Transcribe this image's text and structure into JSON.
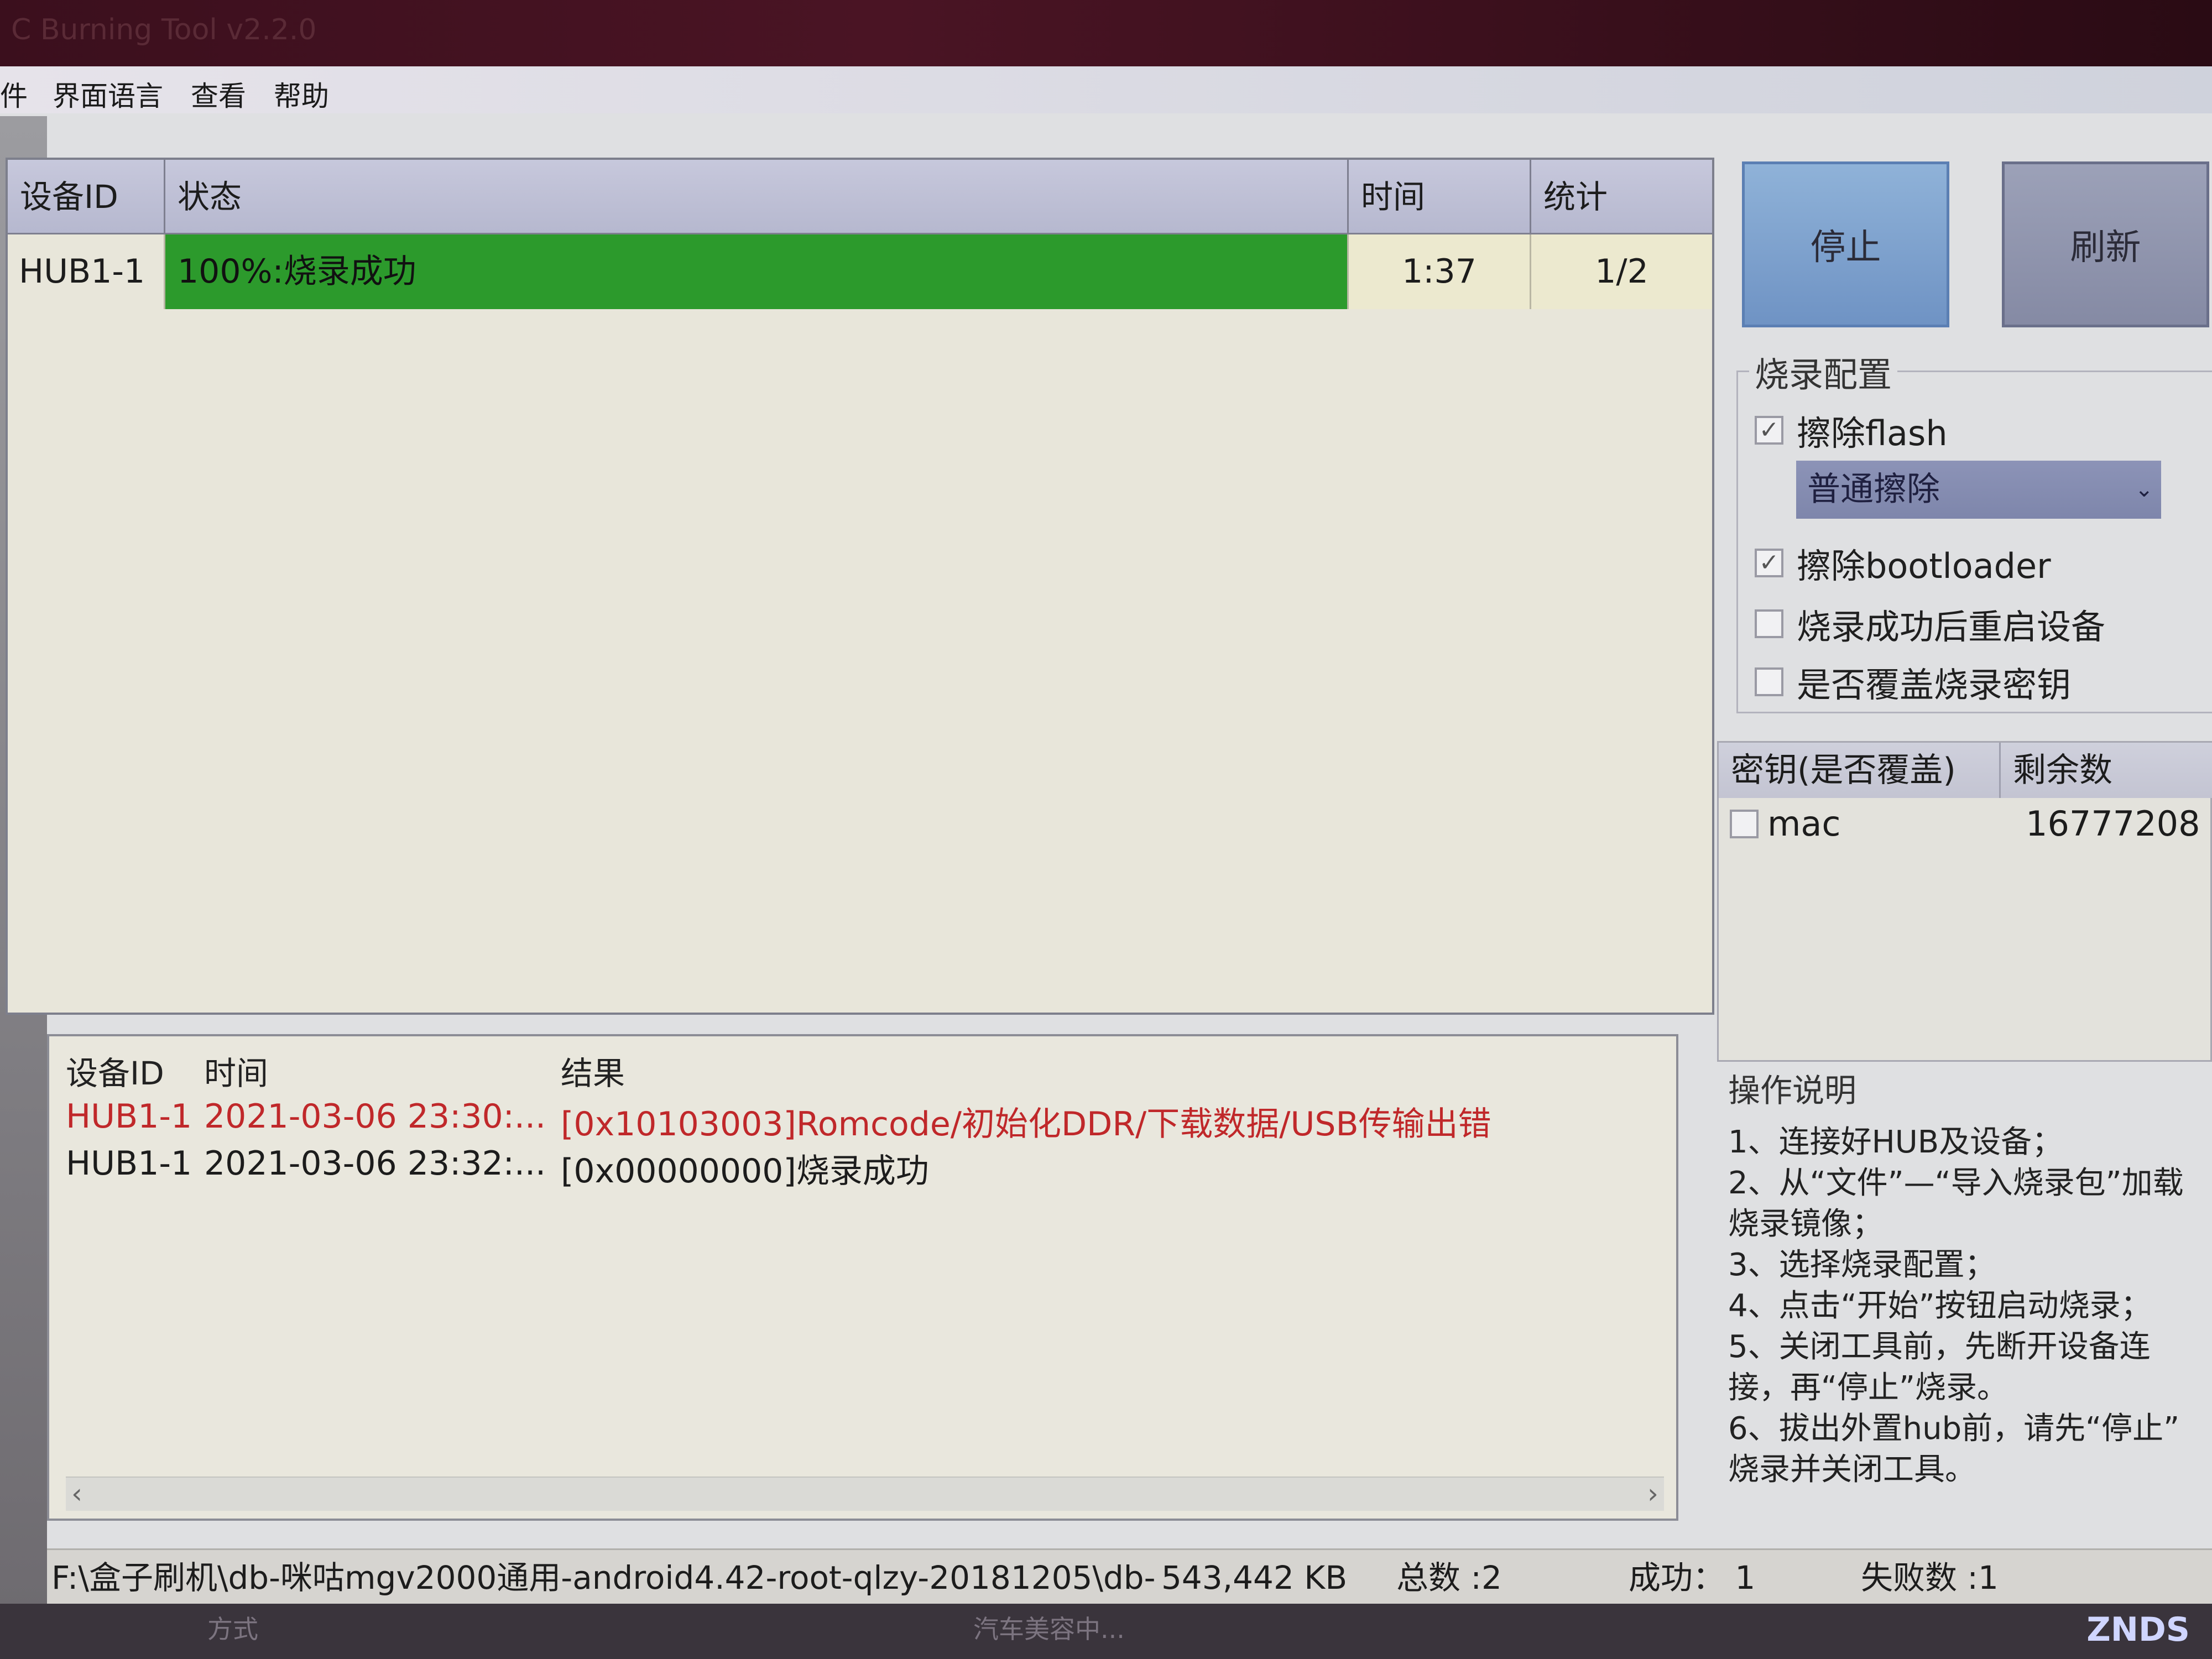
{
  "window": {
    "title": "C Burning Tool v2.2.0"
  },
  "menu": {
    "items": [
      "件",
      "界面语言",
      "查看",
      "帮助"
    ]
  },
  "device_table": {
    "headers": [
      "设备ID",
      "状态",
      "时间",
      "统计"
    ],
    "rows": [
      {
        "device_id": "HUB1-1",
        "status": "100%:烧录成功",
        "time": "1:37",
        "stat": "1/2",
        "progress": 1.0
      }
    ],
    "progress_color": "#2c9a2c"
  },
  "buttons": {
    "stop": "停止",
    "refresh": "刷新"
  },
  "config": {
    "title": "烧录配置",
    "erase_flash": {
      "label": "擦除flash",
      "checked": true
    },
    "erase_mode": "普通擦除",
    "erase_bootloader": {
      "label": "擦除bootloader",
      "checked": true
    },
    "reboot_after": {
      "label": "烧录成功后重启设备",
      "checked": false
    },
    "overwrite_key": {
      "label": "是否覆盖烧录密钥",
      "checked": false
    }
  },
  "key_table": {
    "headers": [
      "密钥(是否覆盖)",
      "剩余数"
    ],
    "rows": [
      {
        "name": "mac",
        "remaining": "16777208",
        "checked": false
      }
    ]
  },
  "instructions": {
    "title": "操作说明",
    "lines": [
      "1、连接好HUB及设备；",
      "2、从“文件”—“导入烧录包”加载",
      "烧录镜像；",
      "3、选择烧录配置；",
      "4、点击“开始”按钮启动烧录；",
      "5、关闭工具前，先断开设备连",
      "接，再“停止”烧录。",
      "6、拔出外置hub前，请先“停止”",
      "烧录并关闭工具。"
    ]
  },
  "log_table": {
    "headers": [
      "设备ID",
      "时间",
      "结果"
    ],
    "rows": [
      {
        "device_id": "HUB1-1",
        "time": "2021-03-06 23:30:...",
        "result": "[0x10103003]Romcode/初始化DDR/下载数据/USB传输出错",
        "error": true
      },
      {
        "device_id": "HUB1-1",
        "time": "2021-03-06 23:32:...",
        "result": "[0x00000000]烧录成功",
        "error": false
      }
    ],
    "error_color": "#c0282a"
  },
  "statusbar": {
    "path": "F:\\盒子刷机\\db-咪咕mgv2000通用-android4.42-root-qlzy-20181205\\db-咪",
    "size": "543,442 KB",
    "total": "总数 :2",
    "success": "成功： 1",
    "failed": "失败数 :1"
  },
  "taskbar": {
    "left_text": "方式",
    "center_text": "汽车美容中...",
    "watermark": "ZNDS"
  }
}
